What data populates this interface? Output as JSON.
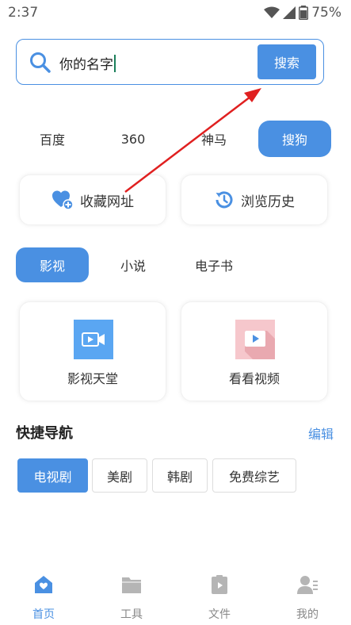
{
  "status_bar": {
    "time": "2:37",
    "battery": "75%"
  },
  "search": {
    "value": "你的名字",
    "button_label": "搜索"
  },
  "engines": [
    {
      "label": "百度",
      "active": false
    },
    {
      "label": "360",
      "active": false
    },
    {
      "label": "神马",
      "active": false
    },
    {
      "label": "搜狗",
      "active": true
    }
  ],
  "quick_actions": {
    "favorites_label": "收藏网址",
    "history_label": "浏览历史"
  },
  "categories": [
    {
      "label": "影视",
      "active": true
    },
    {
      "label": "小说",
      "active": false
    },
    {
      "label": "电子书",
      "active": false
    }
  ],
  "media": {
    "video_heaven_label": "影视天堂",
    "watch_video_label": "看看视频"
  },
  "shortcuts": {
    "title": "快捷导航",
    "edit_label": "编辑",
    "chips": [
      "电视剧",
      "美剧",
      "韩剧",
      "免费综艺"
    ]
  },
  "bottom_nav": [
    {
      "label": "首页",
      "active": true
    },
    {
      "label": "工具",
      "active": false
    },
    {
      "label": "文件",
      "active": false
    },
    {
      "label": "我的",
      "active": false
    }
  ],
  "colors": {
    "accent": "#4a90e2",
    "annotation_arrow": "#e02020"
  }
}
